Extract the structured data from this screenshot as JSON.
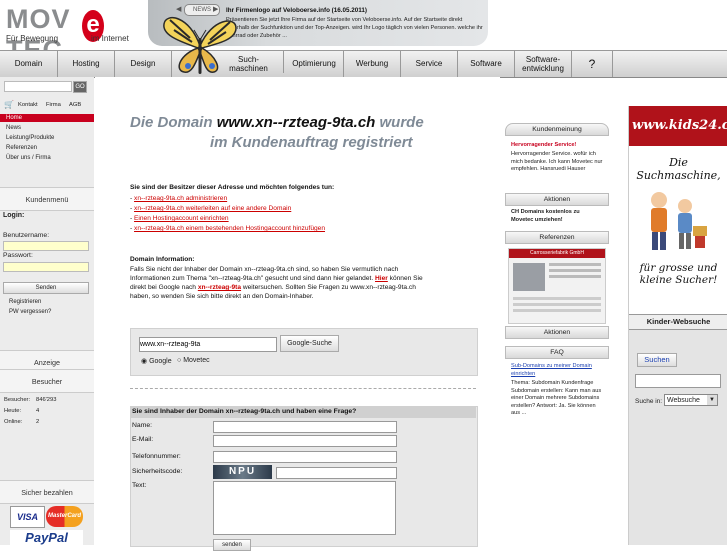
{
  "header": {
    "logo_word": "MOV",
    "logo_e": "e",
    "logo_word2": "TEC",
    "logo_sub1": "Für Bewegung",
    "logo_sub2": "im Internet",
    "news_tab": "NEWS",
    "news_title": "Ihr Firmenlogo auf Veloboerse.info (16.05.2011)",
    "news_text": "Präsentieren Sie jetzt Ihre Firma auf der Startseite von Veloboerse.info. Auf der Startseite direkt unterhalb der Suchfunktion und der Top-Anzeigen. wird Ihr Logo täglich von vielen Personen. welche ihr Fahrrad oder Zubehör ..."
  },
  "nav": [
    {
      "label": "Domain"
    },
    {
      "label": "Hosting"
    },
    {
      "label": "Design"
    },
    {
      "label": "Such-\nmaschinen"
    },
    {
      "label": "Optimierung"
    },
    {
      "label": "Werbung"
    },
    {
      "label": "Service"
    },
    {
      "label": "Software"
    },
    {
      "label": "Software-\nentwicklung"
    },
    {
      "label": "?"
    }
  ],
  "left": {
    "search_button": "GO",
    "top_links": [
      "Kontakt",
      "Firma",
      "AGB"
    ],
    "menu": [
      "Home",
      "News",
      "Leistung/Produkte",
      "Referenzen",
      "Über uns / Firma"
    ],
    "kundenmenu_title": "Kundenmenü",
    "login_label": "Login:",
    "username_label": "Benutzername:",
    "password_label": "Passwort:",
    "send_button": "Senden",
    "register_link": "Registrieren",
    "forgot_link": "PW vergessen?",
    "anzeige_title": "Anzeige",
    "besucher_title": "Besucher",
    "stats": [
      {
        "label": "Besucher:",
        "value": "846'293"
      },
      {
        "label": "Heute:",
        "value": "4"
      },
      {
        "label": "Online:",
        "value": "2"
      }
    ],
    "pay_title": "Sicher bezahlen",
    "visa": "VISA",
    "mastercard": "MasterCard",
    "paypal": "PayPal"
  },
  "main": {
    "title_pre": "Die Domain ",
    "domain": "www.xn--rzteag-9ta.ch",
    "title_post": " wurde",
    "title_line2": "im Kundenauftrag registriert",
    "owner_heading": "Sie sind der Besitzer dieser Adresse und möchten folgendes tun:",
    "owner_links": [
      "xn--rzteag-9ta.ch administrieren",
      "xn--rzteag-9ta.ch weiterleiten auf eine andere Domain",
      "Einen Hostingaccount einrichten",
      "xn--rzteag-9ta.ch einem bestehenden Hostingaccount hinzufügen"
    ],
    "info_heading": "Domain Information:",
    "info_text_1": "Falls Sie nicht der Inhaber der Domain xn--rzteag-9ta.ch sind, so haben Sie vermutlich nach",
    "info_text_2": "Informationen zum Thema \"xn--rzteag-9ta.ch\" gesucht und sind dann hier gelandet. ",
    "info_link_hier": "Hier",
    "info_text_3": " können Sie",
    "info_text_4": "direkt bei Google nach ",
    "info_link_term": "xn--rzteag-9ta",
    "info_text_5": " weitersuchen. Sollten Sie Fragen zu www.xn--rzteag-9ta.ch",
    "info_text_6": "haben, so wenden Sie sich bitte direkt an den Domain-Inhaber.",
    "search_value": "www.xn--rzteag-9ta",
    "search_button": "Google-Suche",
    "radio_google": "Google",
    "radio_movetec": "Movetec",
    "form_heading": "Sie sind Inhaber der Domain xn--rzteag-9ta.ch und haben eine Frage?",
    "form_labels": [
      "Name:",
      "E-Mail:",
      "Telefonnummer:",
      "Sicherheitscode:",
      "Text:"
    ],
    "captcha": "NPU",
    "send_button": "senden"
  },
  "right": {
    "kundenmeinung_title": "Kundenmeinung",
    "kundenmeinung_heading": "Hervorragender Service!",
    "kundenmeinung_text": "Hervorragender Service. wofür ich mich bedanke. Ich kann Movetec nur empfehlen. Hansruedi Hauser",
    "aktionen_title": "Aktionen",
    "aktionen_text": "CH Domains kostenlos zu Movetec umziehen!",
    "referenzen_title": "Referenzen",
    "referenz_site": "Carrosseriefabrik GmbH",
    "aktionen2_title": "Aktionen",
    "faq_title": "FAQ",
    "faq_link": "Sub-Domains zu meiner Domain einrichten",
    "faq_text": "Thema: Subdomain Kundenfrage Subdomain erstellen: Kann man aus einer Domain mehrere Subdomains erstellen? Antwort: Ja. Sie können aus ..."
  },
  "ad": {
    "brand": "www.kids24.ch",
    "slogan1": "Die Suchmaschine,",
    "slogan2": "für grosse und kleine Sucher!",
    "section_title": "Kinder-Websuche",
    "search_button": "Suchen",
    "search_in_label": "Suche in:",
    "select_value": "Websuche"
  },
  "colors": {
    "brand_red": "#d4001a",
    "menu_active": "#c8001e",
    "link": "#cc0000",
    "heading_gray": "#7f8a96"
  }
}
